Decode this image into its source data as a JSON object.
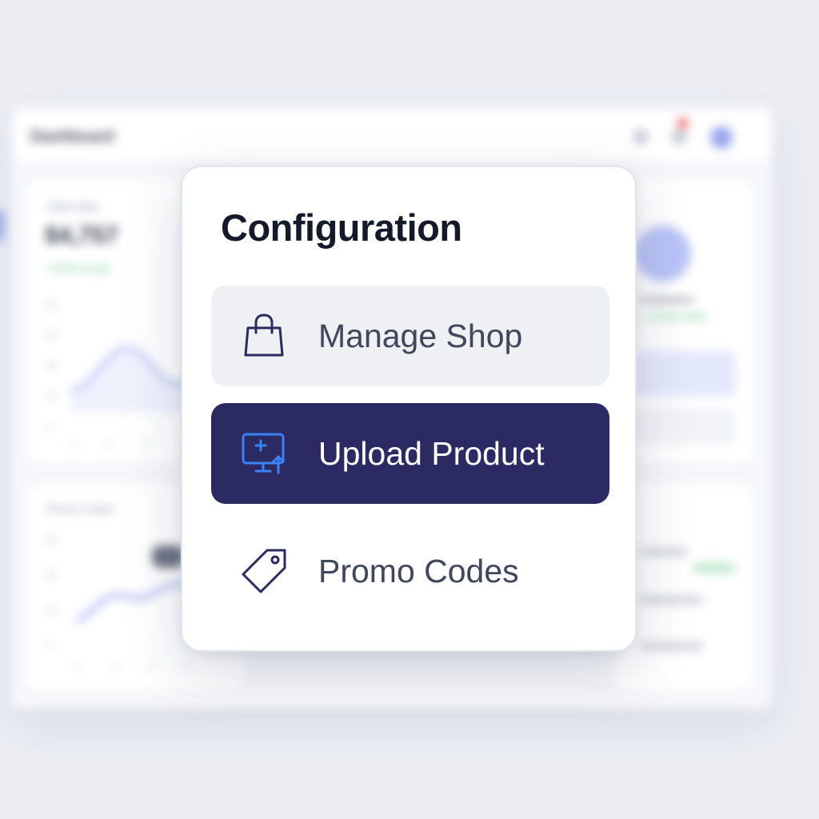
{
  "background": {
    "header_title": "Dashboard",
    "sales_card": {
      "label": "Total sales",
      "value": "$4,757",
      "delta": "+3.5% vs last",
      "y_ticks": [
        "40",
        "30",
        "20",
        "10",
        "0"
      ],
      "x_ticks": [
        "1",
        "2",
        "3",
        "4"
      ]
    },
    "promo_card": {
      "label": "Promo Codes",
      "y_ticks": [
        "40",
        "30",
        "20",
        "0"
      ],
      "x_ticks": [
        "1",
        "2",
        "3",
        "4"
      ]
    },
    "profile_card": {
      "name": "Customers",
      "status": "+ 12 this week"
    }
  },
  "popover": {
    "title": "Configuration",
    "items": [
      {
        "label": "Manage Shop",
        "icon": "shopping-bag-icon",
        "state": "hover"
      },
      {
        "label": "Upload Product",
        "icon": "monitor-upload-icon",
        "state": "selected"
      },
      {
        "label": "Promo Codes",
        "icon": "price-tag-icon",
        "state": "default"
      }
    ]
  },
  "colors": {
    "selected_bg": "#2c2a63",
    "hover_bg": "#eef0f4",
    "selected_icon": "#3b82f6",
    "icon_stroke": "#2a2a5c"
  }
}
